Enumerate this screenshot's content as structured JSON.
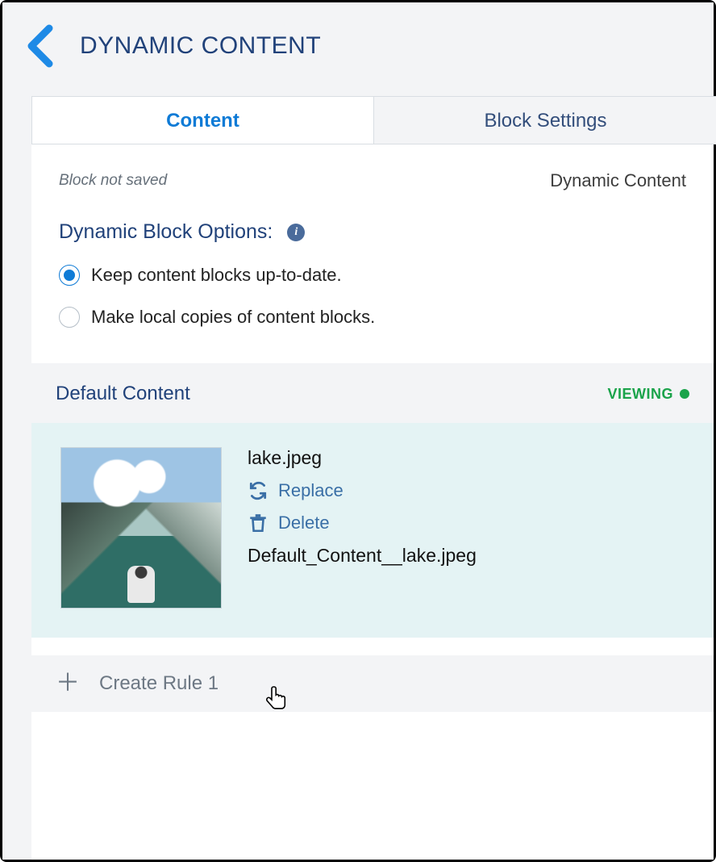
{
  "header": {
    "title": "DYNAMIC CONTENT"
  },
  "tabs": {
    "content": "Content",
    "settings": "Block Settings"
  },
  "status": {
    "not_saved": "Block not saved",
    "type": "Dynamic Content"
  },
  "options": {
    "title": "Dynamic Block Options:",
    "radio1": "Keep content blocks up-to-date.",
    "radio2": "Make local copies of content blocks."
  },
  "default_section": {
    "title": "Default Content",
    "badge": "VIEWING"
  },
  "file": {
    "name": "lake.jpeg",
    "replace": "Replace",
    "delete": "Delete",
    "path": "Default_Content__lake.jpeg"
  },
  "create_rule": {
    "label": "Create Rule 1"
  }
}
